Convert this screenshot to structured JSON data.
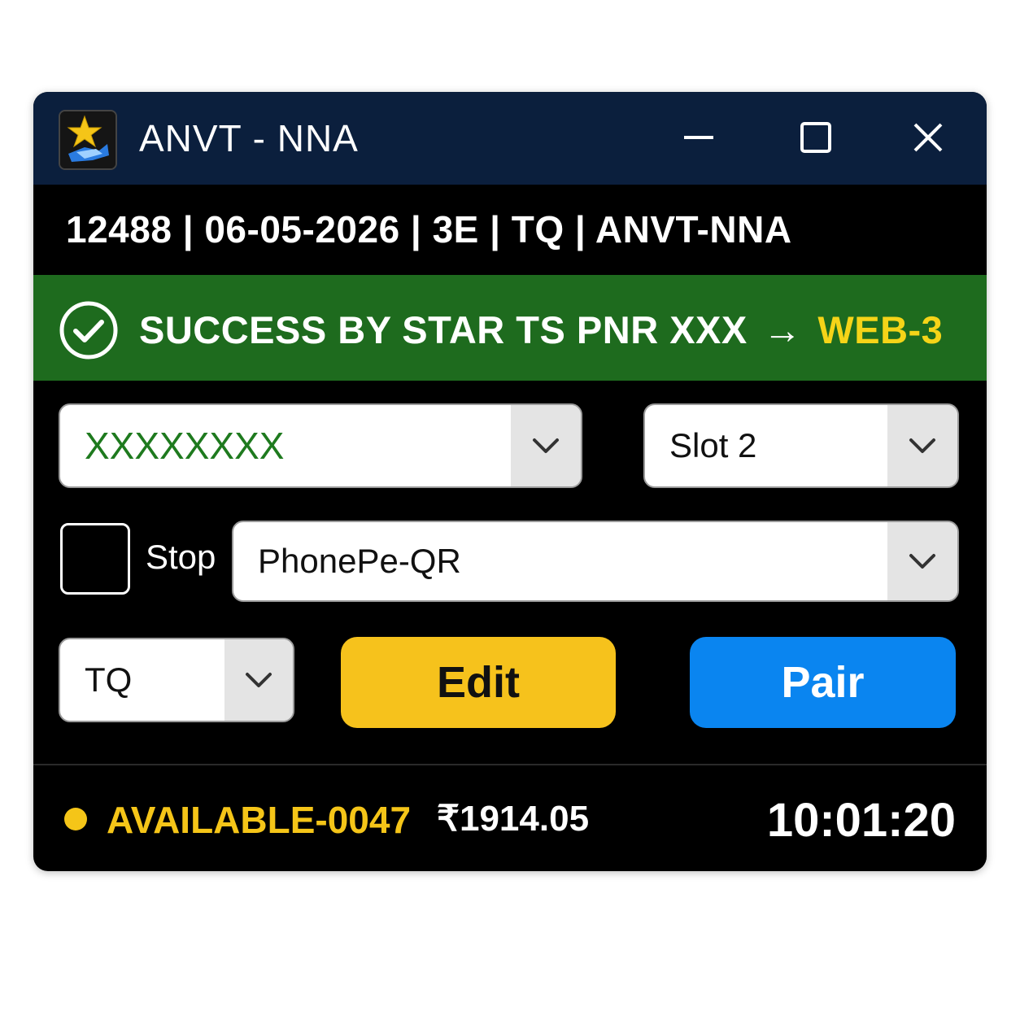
{
  "window": {
    "title": "ANVT - NNA",
    "icon": "star-train-app-icon"
  },
  "header_info": "12488 | 06-05-2026 | 3E | TQ | ANVT-NNA",
  "banner": {
    "icon": "check-circle-icon",
    "text": "SUCCESS BY STAR TS PNR XXX",
    "arrow": "→",
    "target": "WEB-3",
    "accent_color": "#f5d418",
    "background": "#1e6b1e"
  },
  "form": {
    "account_value": "XXXXXXXX",
    "slot_value": "Slot 2",
    "stop_label": "Stop",
    "stop_checked": false,
    "payment_value": "PhonePe-QR",
    "quota_value": "TQ"
  },
  "buttons": {
    "edit_label": "Edit",
    "pair_label": "Pair"
  },
  "status": {
    "text": "AVAILABLE-0047",
    "amount": "₹1914.05",
    "time": "10:01:20",
    "dot_color": "#f5c518"
  }
}
